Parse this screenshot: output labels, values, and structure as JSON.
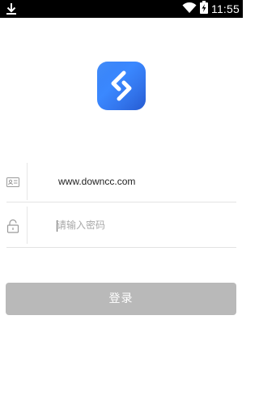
{
  "status_bar": {
    "time": "11:55",
    "download_icon": "download-icon",
    "wifi_icon": "wifi-icon",
    "battery_icon": "battery-charging-icon"
  },
  "app": {
    "logo_icon": "app-logo-icon",
    "brand_color": "#2f7bf5"
  },
  "form": {
    "username_value": "www.downcc.com",
    "username_icon": "id-card-icon",
    "password_placeholder": "请输入密码",
    "password_icon": "lock-icon"
  },
  "login_button": {
    "label": "登录",
    "color": "#b9b9b9"
  }
}
